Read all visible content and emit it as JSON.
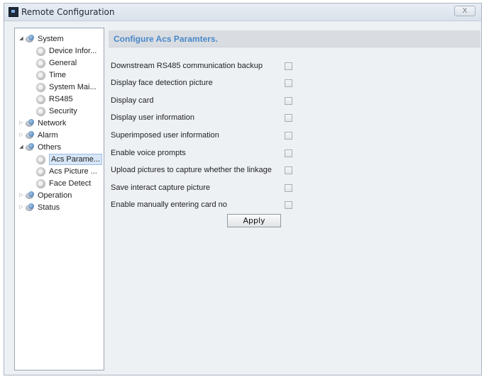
{
  "window": {
    "title": "Remote Configuration",
    "close_label": "X"
  },
  "tree": {
    "items": [
      {
        "label": "System",
        "type": "folder",
        "expanded": true
      },
      {
        "label": "Device Infor...",
        "type": "leaf"
      },
      {
        "label": "General",
        "type": "leaf"
      },
      {
        "label": "Time",
        "type": "leaf"
      },
      {
        "label": "System Mai...",
        "type": "leaf"
      },
      {
        "label": "RS485",
        "type": "leaf"
      },
      {
        "label": "Security",
        "type": "leaf"
      },
      {
        "label": "Network",
        "type": "folder",
        "expanded": false
      },
      {
        "label": "Alarm",
        "type": "folder",
        "expanded": false
      },
      {
        "label": "Others",
        "type": "folder",
        "expanded": true
      },
      {
        "label": "Acs Parame...",
        "type": "leaf",
        "selected": true
      },
      {
        "label": "Acs Picture ...",
        "type": "leaf"
      },
      {
        "label": "Face Detect",
        "type": "leaf"
      },
      {
        "label": "Operation",
        "type": "folder",
        "expanded": false
      },
      {
        "label": "Status",
        "type": "folder",
        "expanded": false
      }
    ]
  },
  "main": {
    "title": "Configure Acs Paramters.",
    "options": [
      {
        "label": "Downstream RS485 communication backup",
        "checked": false
      },
      {
        "label": "Display face detection picture",
        "checked": false
      },
      {
        "label": "Display card",
        "checked": false
      },
      {
        "label": "Display user information",
        "checked": false
      },
      {
        "label": "Superimposed user information",
        "checked": false
      },
      {
        "label": "Enable voice prompts",
        "checked": false
      },
      {
        "label": "Upload pictures to capture whether the linkage",
        "checked": false
      },
      {
        "label": "Save interact capture picture",
        "checked": false
      },
      {
        "label": "Enable manually entering card no",
        "checked": false
      }
    ],
    "apply_label": "Apply"
  },
  "colors": {
    "accent_title": "#4a88c8",
    "selection": "#d7e6f7"
  }
}
